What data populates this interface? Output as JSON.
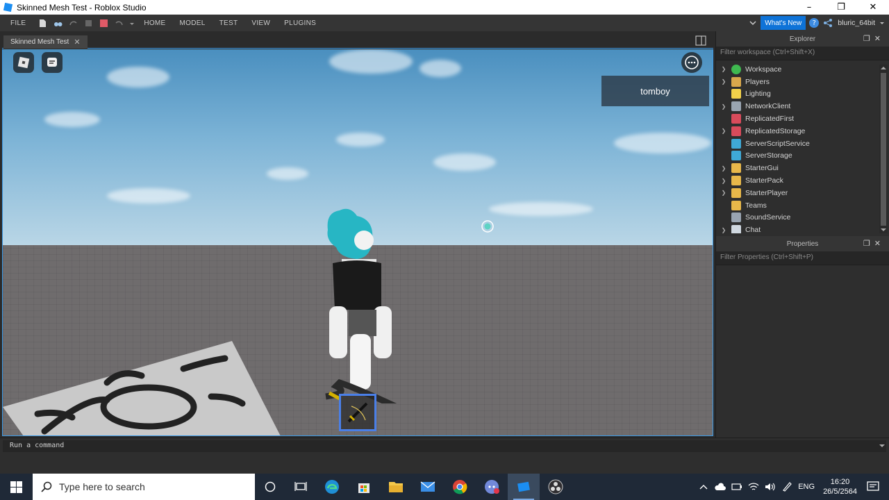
{
  "window": {
    "title": "Skinned Mesh Test - Roblox Studio",
    "minimize": "–",
    "restore": "❐",
    "close": "✕"
  },
  "ribbon": {
    "menus": [
      "FILE",
      "HOME",
      "MODEL",
      "TEST",
      "VIEW",
      "PLUGINS"
    ],
    "whats_new": "What's New",
    "help": "?",
    "username": "bluric_64bit"
  },
  "document_tab": {
    "label": "Skinned Mesh Test",
    "close": "✕"
  },
  "viewport": {
    "player_name": "tomboy"
  },
  "explorer": {
    "title": "Explorer",
    "filter_placeholder": "Filter workspace (Ctrl+Shift+X)",
    "items": [
      {
        "label": "Workspace",
        "expandable": true,
        "icon": "workspace-globe-icon",
        "color": "#3fb950"
      },
      {
        "label": "Players",
        "expandable": true,
        "icon": "players-icon",
        "color": "#d9a84c"
      },
      {
        "label": "Lighting",
        "expandable": false,
        "icon": "lightbulb-icon",
        "color": "#f2d14a"
      },
      {
        "label": "NetworkClient",
        "expandable": true,
        "icon": "network-icon",
        "color": "#9aa5b1"
      },
      {
        "label": "ReplicatedFirst",
        "expandable": false,
        "icon": "replicated-first-icon",
        "color": "#d94b5b"
      },
      {
        "label": "ReplicatedStorage",
        "expandable": true,
        "icon": "replicated-storage-icon",
        "color": "#d94b5b"
      },
      {
        "label": "ServerScriptService",
        "expandable": false,
        "icon": "server-script-icon",
        "color": "#3fa9d6"
      },
      {
        "label": "ServerStorage",
        "expandable": false,
        "icon": "server-storage-icon",
        "color": "#3fa9d6"
      },
      {
        "label": "StarterGui",
        "expandable": true,
        "icon": "starter-gui-icon",
        "color": "#e8b84a"
      },
      {
        "label": "StarterPack",
        "expandable": true,
        "icon": "starter-pack-icon",
        "color": "#e8b84a"
      },
      {
        "label": "StarterPlayer",
        "expandable": true,
        "icon": "starter-player-icon",
        "color": "#e8b84a"
      },
      {
        "label": "Teams",
        "expandable": false,
        "icon": "teams-icon",
        "color": "#e8b84a"
      },
      {
        "label": "SoundService",
        "expandable": false,
        "icon": "sound-icon",
        "color": "#9aa5b1"
      },
      {
        "label": "Chat",
        "expandable": true,
        "icon": "chat-icon",
        "color": "#d0d8e0"
      }
    ]
  },
  "properties": {
    "title": "Properties",
    "filter_placeholder": "Filter Properties (Ctrl+Shift+P)"
  },
  "command_bar": {
    "placeholder": "Run a command"
  },
  "taskbar": {
    "search_placeholder": "Type here to search",
    "language": "ENG",
    "time": "16:20",
    "date": "26/5/2564"
  }
}
